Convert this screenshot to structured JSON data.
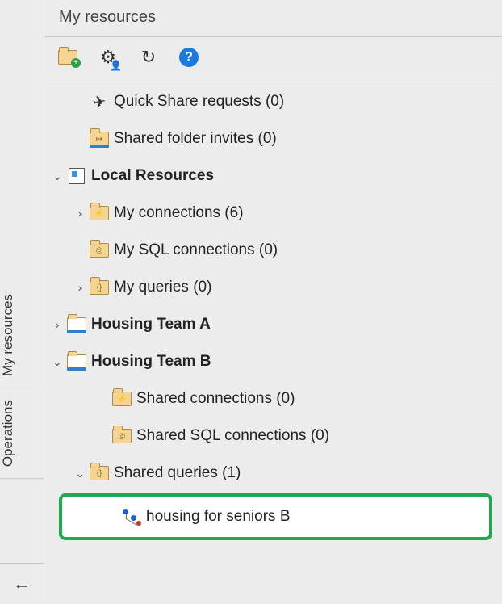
{
  "panel": {
    "title": "My resources"
  },
  "left_tabs": {
    "resources": "My resources",
    "operations": "Operations"
  },
  "tree": {
    "quick_share": {
      "label": "Quick Share requests",
      "count": "(0)"
    },
    "shared_invites": {
      "label": "Shared folder invites",
      "count": "(0)"
    },
    "local": {
      "label": "Local Resources",
      "my_conn": {
        "label": "My connections",
        "count": "(6)"
      },
      "my_sql": {
        "label": "My SQL connections",
        "count": "(0)"
      },
      "my_q": {
        "label": "My queries",
        "count": "(0)"
      }
    },
    "team_a": {
      "label": "Housing Team A"
    },
    "team_b": {
      "label": "Housing Team B",
      "shared_conn": {
        "label": "Shared connections",
        "count": "(0)"
      },
      "shared_sql": {
        "label": "Shared SQL connections",
        "count": "(0)"
      },
      "shared_q": {
        "label": "Shared queries",
        "count": "(1)"
      },
      "item": {
        "label": "housing for seniors B"
      }
    }
  }
}
